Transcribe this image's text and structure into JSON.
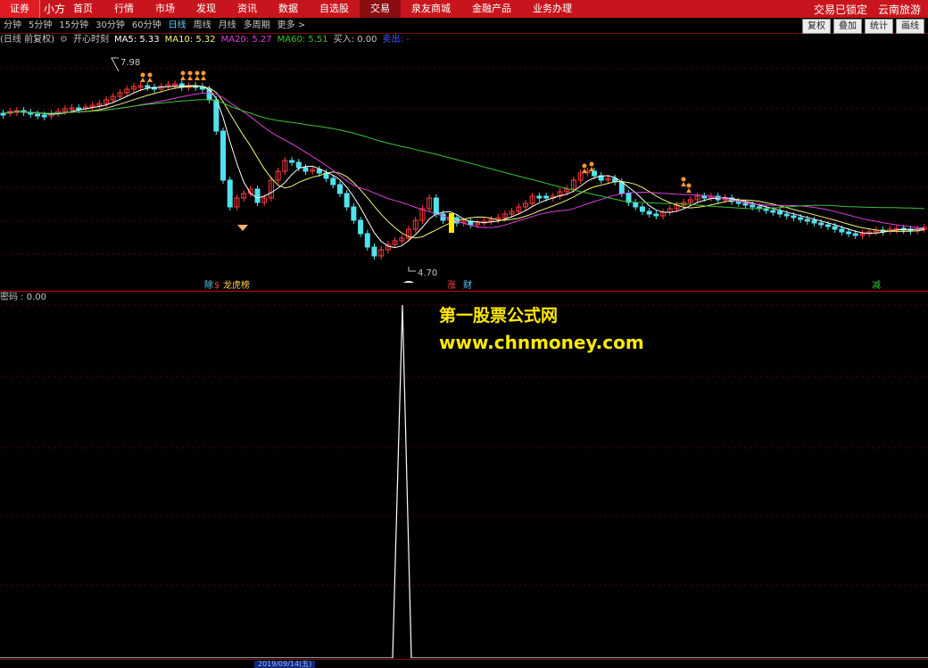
{
  "topnav": {
    "brand_left": "证券",
    "brand_app": "小方",
    "items": [
      {
        "label": "首页"
      },
      {
        "label": "行情"
      },
      {
        "label": "市场"
      },
      {
        "label": "发现"
      },
      {
        "label": "资讯"
      },
      {
        "label": "数据"
      },
      {
        "label": "自选股"
      },
      {
        "label": "交易"
      },
      {
        "label": "泉友商城"
      },
      {
        "label": "金融产品"
      },
      {
        "label": "业务办理"
      }
    ],
    "active_label": "交易",
    "lock_status": "交易已锁定",
    "stock_name": "云南旅游"
  },
  "periodbar": {
    "periods": [
      "分钟",
      "5分钟",
      "15分钟",
      "30分钟",
      "60分钟",
      "日线",
      "周线",
      "月线",
      "多周期",
      "更多 >"
    ],
    "active": "日线",
    "buttons": [
      "复权",
      "叠加",
      "统计",
      "画线"
    ]
  },
  "legend": {
    "adjust": "(日线 前复权)",
    "indicator_name": "开心时刻",
    "ma5": "MA5: 5.33",
    "ma10": "MA10: 5.32",
    "ma20": "MA20: 5.27",
    "ma60": "MA60: 5.51",
    "buy": "买入: 0.00",
    "sell": "卖出: -",
    "colors": {
      "ma5": "#ffffff",
      "ma10": "#f5f57a",
      "ma20": "#e040e0",
      "ma60": "#35c535",
      "buy": "#c8c8c8",
      "sell": "#3d5bff"
    }
  },
  "main_chart": {
    "high_label": "7.98",
    "low_label": "4.70",
    "event_tags": [
      {
        "text": "除",
        "color": "#5fd0ff"
      },
      {
        "text": "$",
        "color": "#ff4040"
      },
      {
        "text": "龙虎榜",
        "color": "#ffd24d"
      },
      {
        "text": "涨",
        "color": "#ff4040"
      },
      {
        "text": "财",
        "color": "#5fd0ff"
      },
      {
        "text": "减",
        "color": "#35c535"
      }
    ]
  },
  "sub_chart": {
    "label": "密码 : 0.00"
  },
  "watermark": {
    "line1": "第一股票公式网",
    "line2": "www.chnmoney.com"
  },
  "bottom_axis": {
    "date": "2019/09/14(五)"
  },
  "chart_data": {
    "type": "candlestick",
    "title": "",
    "high_mark": 7.98,
    "low_mark": 4.7,
    "series": [
      {
        "name": "MA5",
        "values": [
          5.33
        ]
      },
      {
        "name": "MA10",
        "values": [
          5.32
        ]
      },
      {
        "name": "MA20",
        "values": [
          5.27
        ]
      },
      {
        "name": "MA60",
        "values": [
          5.51
        ]
      }
    ],
    "sub_indicator": {
      "name": "密码",
      "value": 0.0,
      "spike_index": "single spike near middle"
    }
  }
}
